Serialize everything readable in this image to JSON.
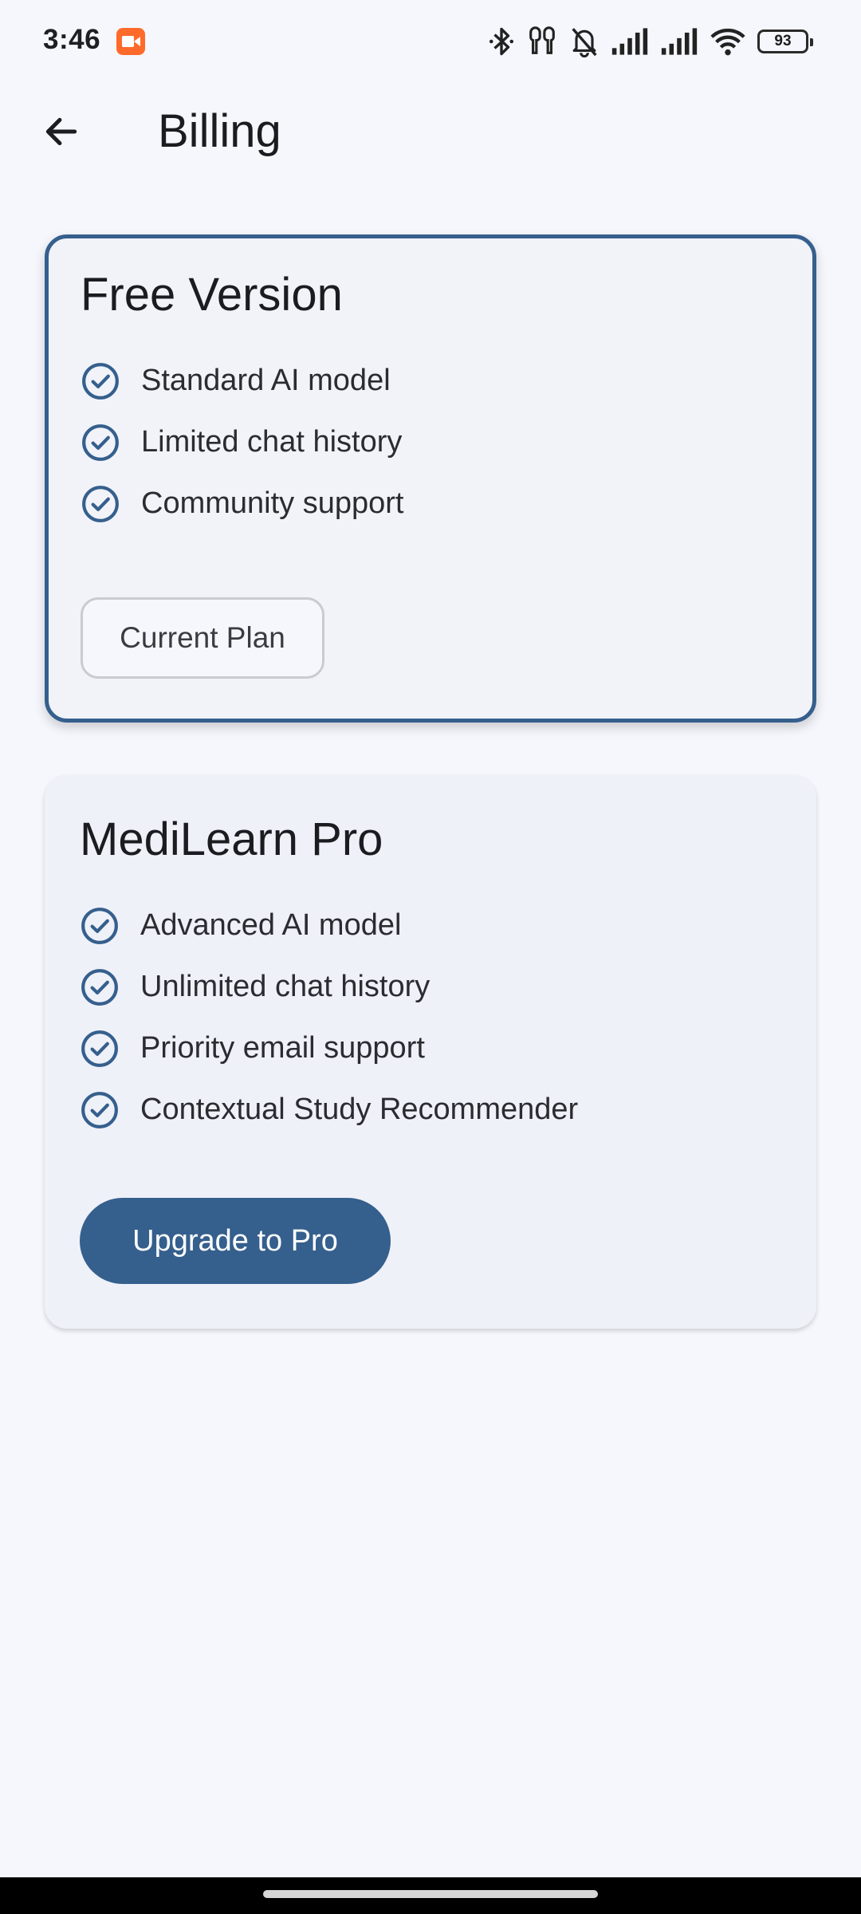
{
  "status_bar": {
    "time": "3:46",
    "battery": "93",
    "icons": [
      "screen-record-icon",
      "bluetooth-icon",
      "earbuds-icon",
      "bell-off-icon",
      "signal-icon",
      "signal-icon",
      "wifi-icon",
      "battery-icon"
    ]
  },
  "app_bar": {
    "title": "Billing",
    "back_icon": "arrow-back-icon"
  },
  "plans": {
    "free": {
      "title": "Free Version",
      "features": [
        "Standard AI model",
        "Limited chat history",
        "Community support"
      ],
      "button_label": "Current Plan"
    },
    "pro": {
      "title": "MediLearn Pro",
      "features": [
        "Advanced AI model",
        "Unlimited chat history",
        "Priority email support",
        "Contextual Study Recommender"
      ],
      "button_label": "Upgrade to Pro"
    }
  },
  "colors": {
    "accent": "#355f8d",
    "background": "#f6f7fc",
    "card": "#eff1f8"
  }
}
